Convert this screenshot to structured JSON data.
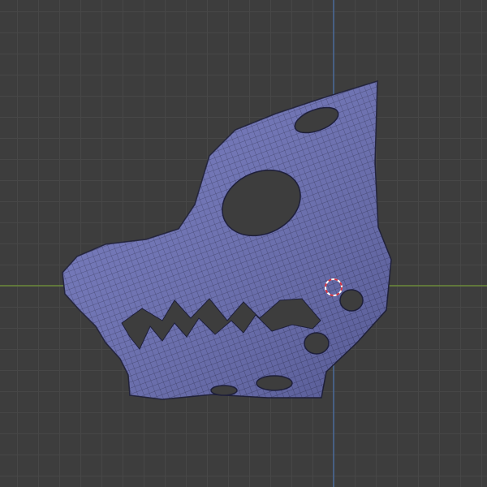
{
  "viewport": {
    "object": "wolf-mask-mesh",
    "colors": {
      "background": "#3d3d3d",
      "grid": "#474747",
      "x_axis": "#6b8a3a",
      "z_axis": "#4a6a9a",
      "mesh_fill": "#6b70b8",
      "wire": "#2a2c55",
      "cursor": "#d03040"
    }
  }
}
